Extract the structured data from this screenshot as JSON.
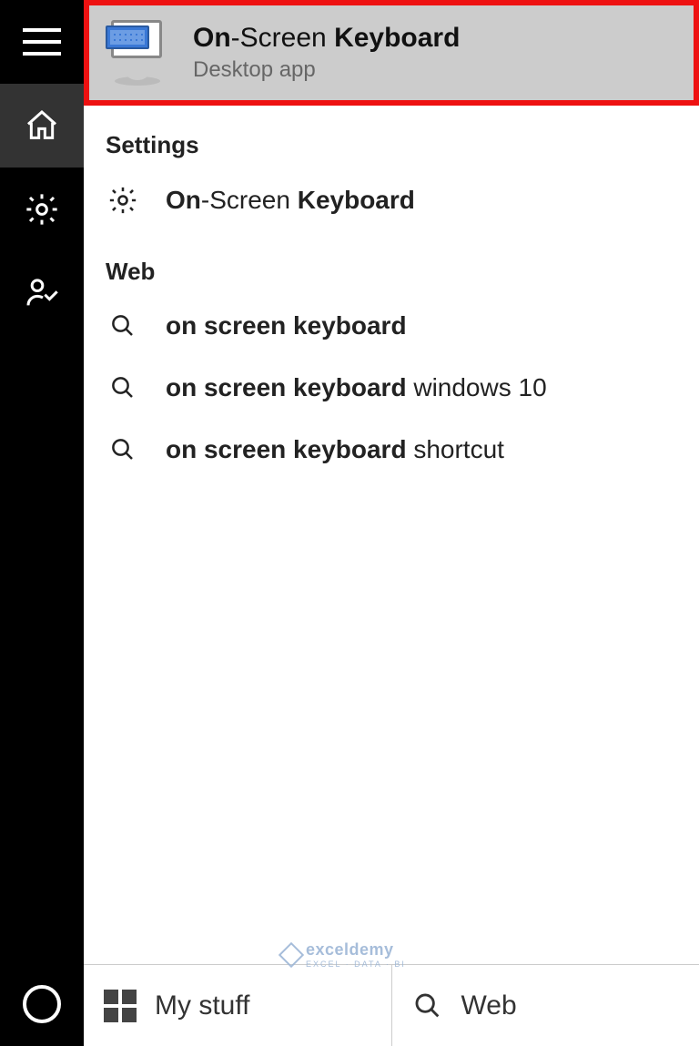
{
  "bestMatch": {
    "title_html": "<b>On</b>-Screen <b>Keyboard</b>",
    "subtitle": "Desktop app"
  },
  "sections": {
    "settings": {
      "header": "Settings",
      "items": [
        {
          "html": "<b>On</b>-Screen <b>Keyboard</b>"
        }
      ]
    },
    "web": {
      "header": "Web",
      "items": [
        {
          "html": "<b>on screen keyboard</b>"
        },
        {
          "html": "<b>on screen keyboard</b> windows 10"
        },
        {
          "html": "<b>on screen keyboard</b> shortcut"
        }
      ]
    }
  },
  "bottom": {
    "mystuff": "My stuff",
    "web": "Web"
  },
  "watermark": {
    "brand": "exceldemy",
    "tag": "EXCEL · DATA · BI"
  }
}
